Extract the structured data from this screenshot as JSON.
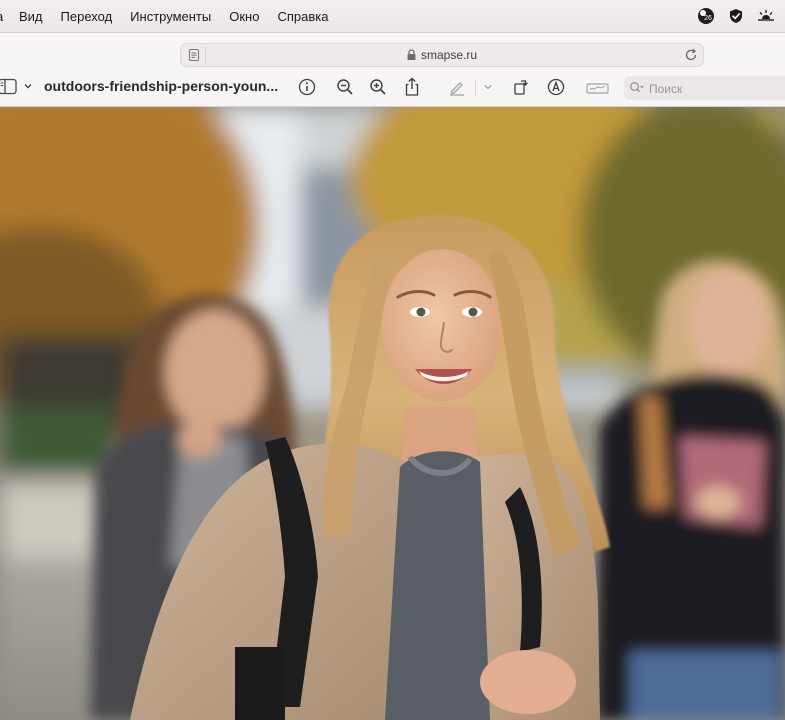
{
  "menubar": {
    "edge_char": "a",
    "items": [
      "Вид",
      "Переход",
      "Инструменты",
      "Окно",
      "Справка"
    ],
    "status": {
      "notification_count": "26"
    }
  },
  "address": {
    "url": "smapse.ru"
  },
  "toolbar": {
    "document_title": "outdoors-friendship-person-youn...",
    "search_placeholder": "Поиск"
  },
  "icons": {
    "menubar": [
      "notification-badge-icon",
      "checkmark-shield-icon",
      "brightness-icon"
    ],
    "address": [
      "reader-icon",
      "lock-icon",
      "reload-icon"
    ],
    "toolbar": [
      "sidebar-toggle-icon",
      "chevron-down-icon",
      "info-icon",
      "zoom-out-icon",
      "zoom-in-icon",
      "share-icon",
      "highlight-pen-icon",
      "chevron-down-icon",
      "rotate-icon",
      "markup-icon",
      "signature-icon",
      "search-icon"
    ]
  },
  "colors": {
    "menubar_bg": "#efeaea",
    "chrome_bg": "#f6f4f5",
    "address_bg": "#eeeaeb",
    "title_text": "#2a2a2a"
  }
}
